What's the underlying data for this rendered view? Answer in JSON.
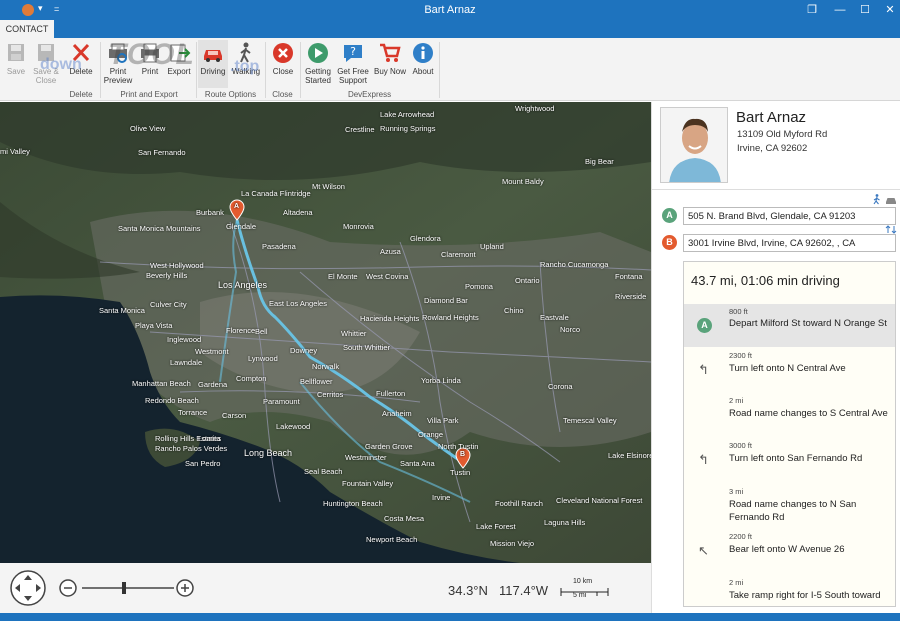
{
  "window": {
    "title": "Bart Arnaz",
    "controls": {
      "restore": "❐",
      "minimize": "—",
      "maximize": "☐",
      "close": "✕"
    },
    "quick_access_caret": "▾",
    "quick_access_sep": "="
  },
  "ribbon": {
    "tab": "CONTACT",
    "watermark": "TOOL",
    "watermark_prefix": "down",
    "watermark_suffix": ".top",
    "buttons": {
      "save": "Save",
      "save_close_1": "Save &",
      "save_close_2": "Close",
      "delete": "Delete",
      "print_preview_1": "Print",
      "print_preview_2": "Preview",
      "print": "Print",
      "export": "Export",
      "driving": "Driving",
      "walking": "Walking",
      "close": "Close",
      "getting_started_1": "Getting",
      "getting_started_2": "Started",
      "free_support_1": "Get Free",
      "free_support_2": "Support",
      "buy_now": "Buy Now",
      "about": "About"
    },
    "groups": {
      "delete": "Delete",
      "print_export": "Print and Export",
      "route_options": "Route Options",
      "close": "Close",
      "devexpress": "DevExpress"
    }
  },
  "map": {
    "labels": [
      {
        "t": "Olive View"
      },
      {
        "t": "San Fernando"
      },
      {
        "t": "mi Valley"
      },
      {
        "t": "Wrightwood"
      },
      {
        "t": "Lake Arrowhead"
      },
      {
        "t": "Running Springs"
      },
      {
        "t": "Crestline"
      },
      {
        "t": "Big Bear"
      },
      {
        "t": "Mount Baldy"
      },
      {
        "t": "Mt Wilson"
      },
      {
        "t": "La Canada Flintridge"
      },
      {
        "t": "Burbank"
      },
      {
        "t": "Glendale"
      },
      {
        "t": "Altadena"
      },
      {
        "t": "Monrovia"
      },
      {
        "t": "Rancho Cucamonga"
      },
      {
        "t": "Santa Monica Mountains"
      },
      {
        "t": "West Hollywood"
      },
      {
        "t": "Beverly Hills"
      },
      {
        "t": "Los Angeles"
      },
      {
        "t": "El Monte"
      },
      {
        "t": "West Covina"
      },
      {
        "t": "Pomona"
      },
      {
        "t": "Ontario"
      },
      {
        "t": "Riverside"
      },
      {
        "t": "Fontana"
      },
      {
        "t": "Santa Monica"
      },
      {
        "t": "Culver City"
      },
      {
        "t": "Playa Vista"
      },
      {
        "t": "East Los Angeles"
      },
      {
        "t": "Inglewood"
      },
      {
        "t": "Hacienda Heights"
      },
      {
        "t": "Chino"
      },
      {
        "t": "Norco"
      },
      {
        "t": "Eastvale"
      },
      {
        "t": "Lynwood"
      },
      {
        "t": "Compton"
      },
      {
        "t": "Norwalk"
      },
      {
        "t": "Manhattan Beach"
      },
      {
        "t": "Redondo Beach"
      },
      {
        "t": "Torrance"
      },
      {
        "t": "Carson"
      },
      {
        "t": "Cerritos"
      },
      {
        "t": "Fullerton"
      },
      {
        "t": "Yorba Linda"
      },
      {
        "t": "Corona"
      },
      {
        "t": "Anaheim"
      },
      {
        "t": "Villa Park"
      },
      {
        "t": "Orange"
      },
      {
        "t": "Garden Grove"
      },
      {
        "t": "Westminster"
      },
      {
        "t": "Long Beach"
      },
      {
        "t": "Santa Ana"
      },
      {
        "t": "North Tustin"
      },
      {
        "t": "Tustin"
      },
      {
        "t": "Irvine"
      },
      {
        "t": "Huntington Beach"
      },
      {
        "t": "Costa Mesa"
      },
      {
        "t": "Newport Beach"
      },
      {
        "t": "Lake Forest"
      },
      {
        "t": "Mission Viejo"
      },
      {
        "t": "Foothill Ranch"
      },
      {
        "t": "Cleveland National Forest"
      },
      {
        "t": "Temescal Valley"
      },
      {
        "t": "Lake Elsinore"
      },
      {
        "t": "Rancho Palos Verdes"
      },
      {
        "t": "San Pedro"
      },
      {
        "t": "Rolling Hills Estates"
      },
      {
        "t": "Downey"
      },
      {
        "t": "Whittier"
      },
      {
        "t": "South Whittier"
      },
      {
        "t": "Rowland Heights"
      },
      {
        "t": "Diamond Bar"
      },
      {
        "t": "Claremont"
      },
      {
        "t": "Upland"
      },
      {
        "t": "Glendora"
      },
      {
        "t": "Azusa"
      },
      {
        "t": "Pasadena"
      },
      {
        "t": "Bell"
      },
      {
        "t": "Westmont"
      },
      {
        "t": "Lawndale"
      },
      {
        "t": "Gardena"
      },
      {
        "t": "Florence"
      },
      {
        "t": "Paramount"
      },
      {
        "t": "Lakewood"
      },
      {
        "t": "Bellflower"
      },
      {
        "t": "Seal Beach"
      },
      {
        "t": "Fountain Valley"
      },
      {
        "t": "Lomita"
      },
      {
        "t": "Laguna Hills"
      }
    ],
    "coord_lat": "34.3°N",
    "coord_lng": "117.4°W",
    "scale_km": "10 km",
    "scale_mi": "5 mi",
    "marker_a": "A",
    "marker_b": "B"
  },
  "contact": {
    "name": "Bart Arnaz",
    "street": "13109 Old Myford Rd",
    "city": "Irvine, CA 92602"
  },
  "route": {
    "from": "505 N. Brand Blvd, Glendale, CA 91203",
    "to": "3001 Irvine Blvd, Irvine, CA 92602, , CA",
    "summary": "43.7 mi, 01:06 min driving",
    "steps": [
      {
        "dist": "800 ft",
        "text": "Depart Milford St toward N Orange St",
        "icon": "A"
      },
      {
        "dist": "2300 ft",
        "text": "Turn left onto N Central Ave",
        "icon": "↰"
      },
      {
        "dist": "2 mi",
        "text": "Road name changes to S Central Ave",
        "icon": ""
      },
      {
        "dist": "3000 ft",
        "text": "Turn left onto San Fernando Rd",
        "icon": "↰"
      },
      {
        "dist": "3 mi",
        "text": "Road name changes to N San Fernando Rd",
        "icon": ""
      },
      {
        "dist": "2200 ft",
        "text": "Bear left onto W Avenue 26",
        "icon": "↖"
      },
      {
        "dist": "2 mi",
        "text": "Take ramp right for I-5 South toward",
        "icon": ""
      }
    ]
  },
  "colors": {
    "accent": "#1e73be",
    "marker": "#e35b2f",
    "badge_a": "#5aa37b",
    "route": "#69c0e0"
  }
}
